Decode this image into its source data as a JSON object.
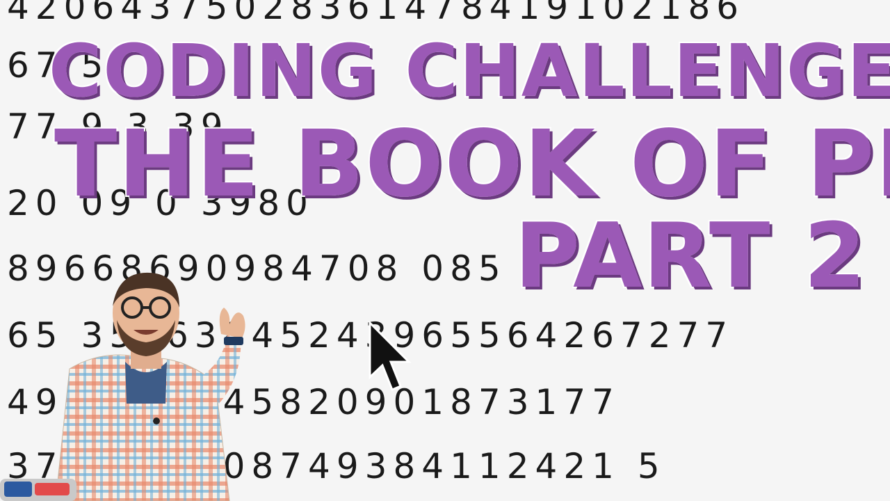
{
  "title": {
    "line1": "CODING CHALLENGE:",
    "line2": "THE BOOK OF PI",
    "line3": "PART 2"
  },
  "digit_rows": [
    "42064375028361478419102186",
    "67                        5",
    "77         9          3  39",
    "20    09            0  3980",
    "89668690984708           085",
    "65 35563845243965564267277",
    "49  9459045820901873177",
    "37  5902408749384112421 5"
  ],
  "colors": {
    "title_fill": "#9b59b6",
    "title_shadow": "#6b3a80",
    "background": "#f5f5f5",
    "digits": "#1a1a1a"
  },
  "icons": {
    "cursor": "mouse-pointer-icon",
    "logo": "coding-train-logo"
  }
}
